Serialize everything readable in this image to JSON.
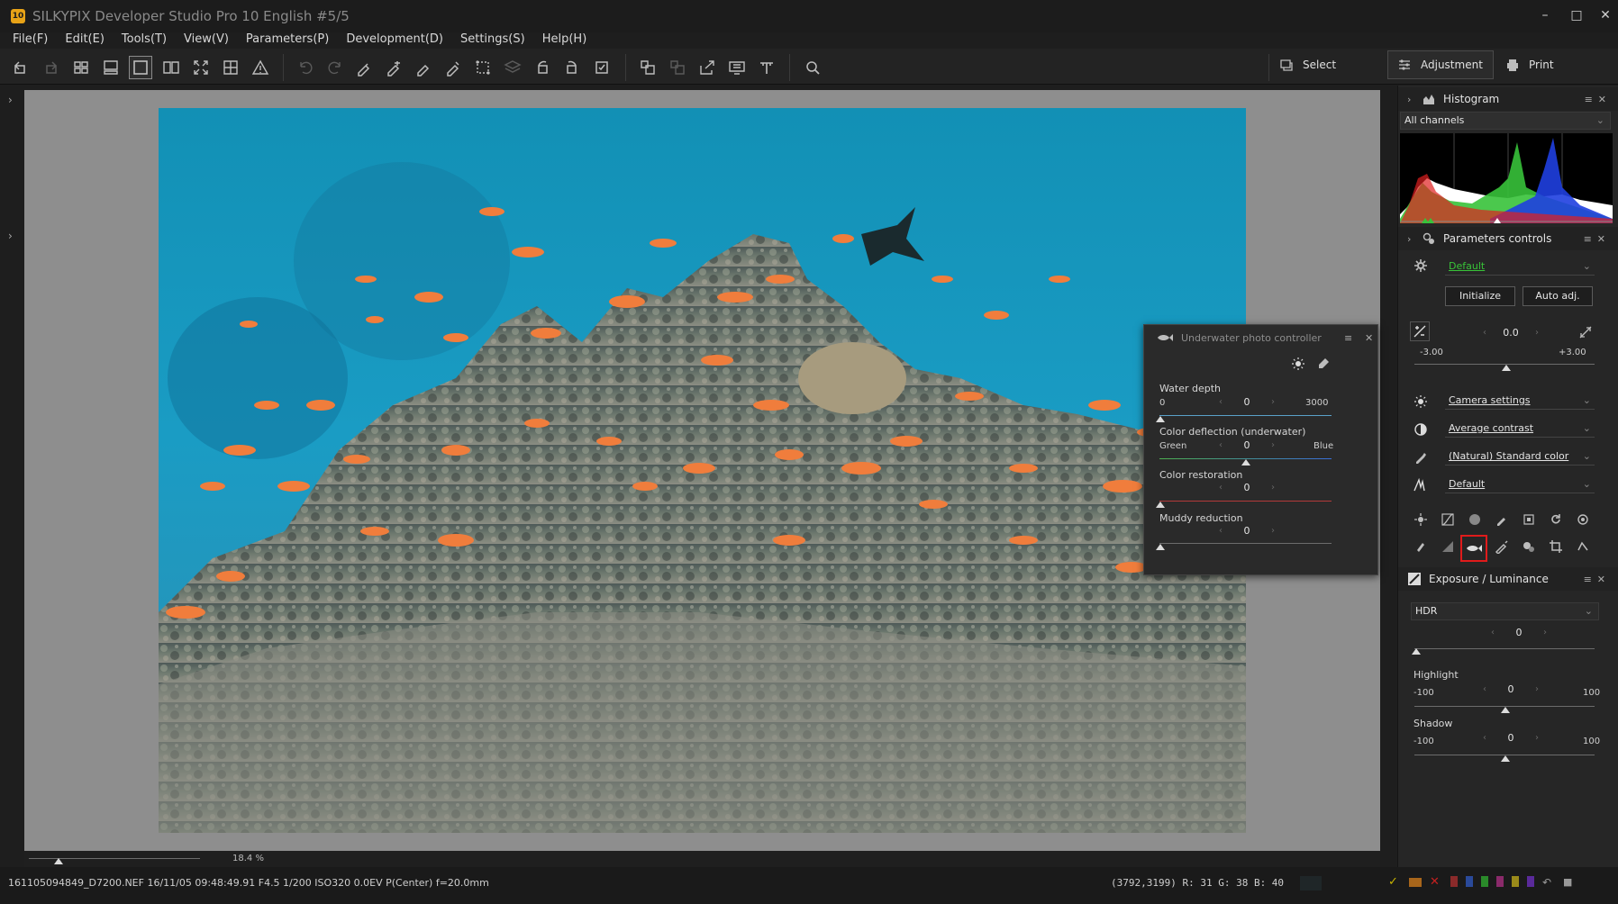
{
  "window": {
    "title": "SILKYPIX Developer Studio Pro 10 English   #5/5",
    "logo": "10",
    "controls": [
      "minimize-icon",
      "maximize-icon",
      "close-icon"
    ]
  },
  "menu": [
    "File(F)",
    "Edit(E)",
    "Tools(T)",
    "View(V)",
    "Parameters(P)",
    "Development(D)",
    "Settings(S)",
    "Help(H)"
  ],
  "modes": {
    "select": "Select",
    "adjustment": "Adjustment",
    "print": "Print"
  },
  "viewer": {
    "zoom_value": "18.4",
    "zoom_unit": "%"
  },
  "status": {
    "file_info": "161105094849_D7200.NEF 16/11/05 09:48:49.91 F4.5 1/200 ISO320  0.0EV P(Center) f=20.0mm",
    "pixel_info": "(3792,3199) R: 31 G: 38 B: 40",
    "swatch_color": "#1f2628"
  },
  "histogram": {
    "title": "Histogram",
    "channel_select": "All channels"
  },
  "parameters_controls": {
    "title": "Parameters controls",
    "preset": "Default",
    "initialize_label": "Initialize",
    "auto_adj_label": "Auto adj.",
    "exposure_value": "0.0",
    "exposure_min": "-3.00",
    "exposure_max": "+3.00",
    "white_balance": "Camera settings",
    "contrast": "Average contrast",
    "color": "(Natural) Standard color",
    "sharpness": "Default"
  },
  "exposure_luminance": {
    "title": "Exposure / Luminance",
    "mode_select": "HDR",
    "hdr_value": "0",
    "highlight_label": "Highlight",
    "highlight_min": "-100",
    "highlight_max": "100",
    "highlight_value": "0",
    "shadow_label": "Shadow",
    "shadow_min": "-100",
    "shadow_max": "100",
    "shadow_value": "0"
  },
  "underwater": {
    "title": "Underwater photo controller",
    "water_depth_label": "Water depth",
    "water_depth_min": "0",
    "water_depth_max": "3000",
    "water_depth_value": "0",
    "color_deflection_label": "Color deflection (underwater)",
    "color_deflection_left": "Green",
    "color_deflection_right": "Blue",
    "color_deflection_value": "0",
    "color_restoration_label": "Color restoration",
    "color_restoration_value": "0",
    "muddy_reduction_label": "Muddy reduction",
    "muddy_reduction_value": "0"
  },
  "colors": {
    "accent_green": "#38c438",
    "selection_red": "#e01b1b",
    "panel_bg": "#262626"
  }
}
